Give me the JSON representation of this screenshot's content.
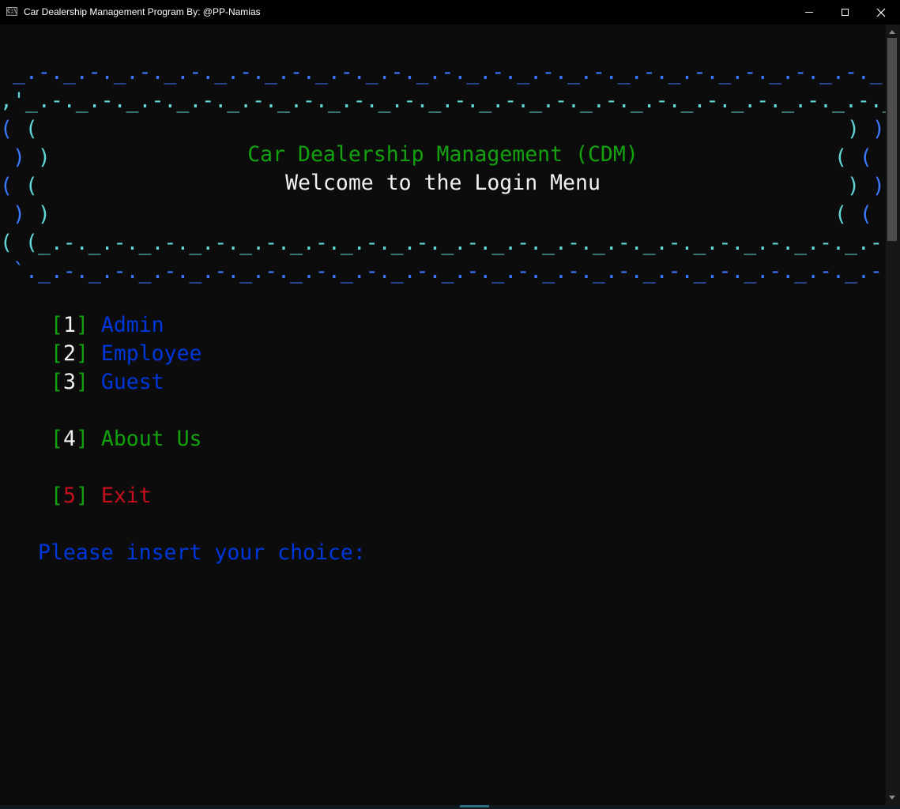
{
  "window": {
    "title": "Car Dealership Management Program By: @PP-Namias",
    "icon_text": "C:\\",
    "controls": [
      "minimize",
      "maximize",
      "close"
    ]
  },
  "banner": {
    "border_top_outer": " _.-._.-._.-._.-._.-._.-._.-._.-._.-._.-._.-._.-._.-._.-._.-._.-._.-._.-._.-._",
    "border_top_inner": ",'_.-._.-._.-._.-._.-._.-._.-._.-._.-._.-._.-._.-._.-._.-._.-._.-._.-._.-._.-._.`.",
    "border_bottom_inner": "( (_.-._.-._.-._.-._.-._.-._.-._.-._.-._.-._.-._.-._.-._.-._.-._.-._.-._.-._.-._) )",
    "border_bottom_outer": "`._.-._.-._.-._.-._.-._.-._.-._.-._.-._.-._.-._.-._.-._.-._.-._.-._.-._.-._.-._.'",
    "title": "Car Dealership Management (CDM)",
    "subtitle": "Welcome to the Login Menu"
  },
  "menu": [
    {
      "number": "1",
      "label": "Admin"
    },
    {
      "number": "2",
      "label": "Employee"
    },
    {
      "number": "3",
      "label": "Guest"
    },
    {
      "number": "4",
      "label": "About Us"
    },
    {
      "number": "5",
      "label": "Exit"
    }
  ],
  "prompt": "Please insert your choice:",
  "colors": {
    "background": "#0c0c0c",
    "border_blue": "#3b78ff",
    "border_cyan": "#61d6d6",
    "title_green": "#13a10e",
    "subtitle_white": "#f2f2f2",
    "menu_blue": "#0037da",
    "exit_red": "#c50f1f"
  }
}
